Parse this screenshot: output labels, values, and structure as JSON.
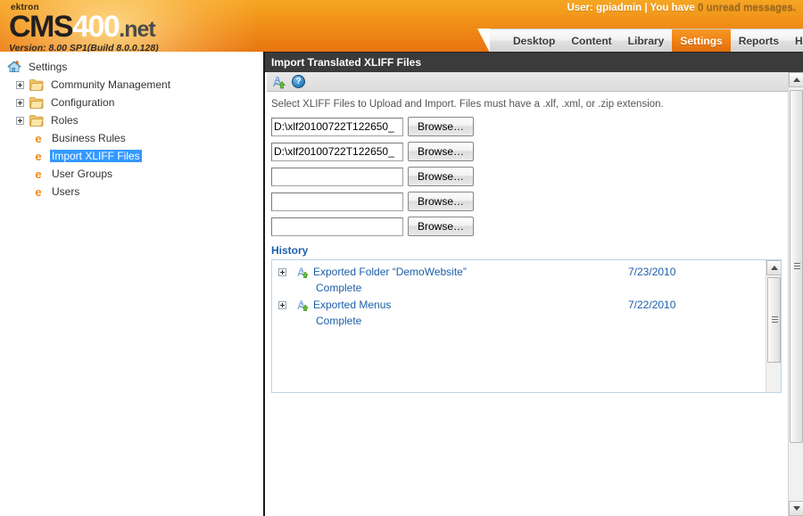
{
  "header": {
    "logo_brand": "ektron",
    "logo_cms": "CMS",
    "logo_400": "400",
    "logo_net": ".net",
    "version": "Version: 8.00 SP1(Build 8.0.0.128)",
    "user_prefix": "User: gpiadmin | You have",
    "user_messages": "0 unread messages."
  },
  "nav": {
    "tabs": [
      {
        "label": "Desktop",
        "active": false
      },
      {
        "label": "Content",
        "active": false
      },
      {
        "label": "Library",
        "active": false
      },
      {
        "label": "Settings",
        "active": true
      },
      {
        "label": "Reports",
        "active": false
      },
      {
        "label": "Help",
        "active": false
      }
    ]
  },
  "titlebar": {
    "help_glyph": "?",
    "title": "Import Translated XLIFF Files"
  },
  "sidebar": {
    "items": [
      {
        "label": "Settings",
        "icon": "home-icon",
        "indent": 0,
        "expander": false,
        "selected": false
      },
      {
        "label": "Community Management",
        "icon": "folder-icon",
        "indent": 1,
        "expander": true,
        "selected": false
      },
      {
        "label": "Configuration",
        "icon": "folder-icon",
        "indent": 1,
        "expander": true,
        "selected": false
      },
      {
        "label": "Roles",
        "icon": "folder-icon",
        "indent": 1,
        "expander": true,
        "selected": false
      },
      {
        "label": "Business Rules",
        "icon": "ektron-e-icon",
        "indent": 2,
        "expander": false,
        "selected": false
      },
      {
        "label": "Import XLIFF Files",
        "icon": "ektron-e-icon",
        "indent": 2,
        "expander": false,
        "selected": true
      },
      {
        "label": "User Groups",
        "icon": "ektron-e-icon",
        "indent": 2,
        "expander": false,
        "selected": false
      },
      {
        "label": "Users",
        "icon": "ektron-e-icon",
        "indent": 2,
        "expander": false,
        "selected": false
      }
    ]
  },
  "toolbar": {
    "import_icon": "import-xliff-icon",
    "help_icon": "help-icon",
    "help_glyph": "?"
  },
  "main": {
    "instructions": "Select XLIFF Files to Upload and Import. Files must have a .xlf, .xml, or .zip extension.",
    "browse_label": "Browse…",
    "upload_rows": [
      {
        "value": "D:\\xlf20100722T122650_",
        "placeholder": ""
      },
      {
        "value": "D:\\xlf20100722T122650_",
        "placeholder": ""
      },
      {
        "value": "",
        "placeholder": ""
      },
      {
        "value": "",
        "placeholder": ""
      },
      {
        "value": "",
        "placeholder": ""
      }
    ],
    "history_title": "History",
    "history_items": [
      {
        "name": "Exported Folder “DemoWebsite”",
        "date": "7/23/2010",
        "status": "Complete"
      },
      {
        "name": "Exported Menus",
        "date": "7/22/2010",
        "status": "Complete"
      }
    ]
  },
  "colors": {
    "brand_orange": "#ef8a15",
    "active_tab": "#ef7f14",
    "selection_blue": "#3399ff",
    "link_blue": "#1c5fa8",
    "titlebar_dark": "#3b3b3b"
  }
}
